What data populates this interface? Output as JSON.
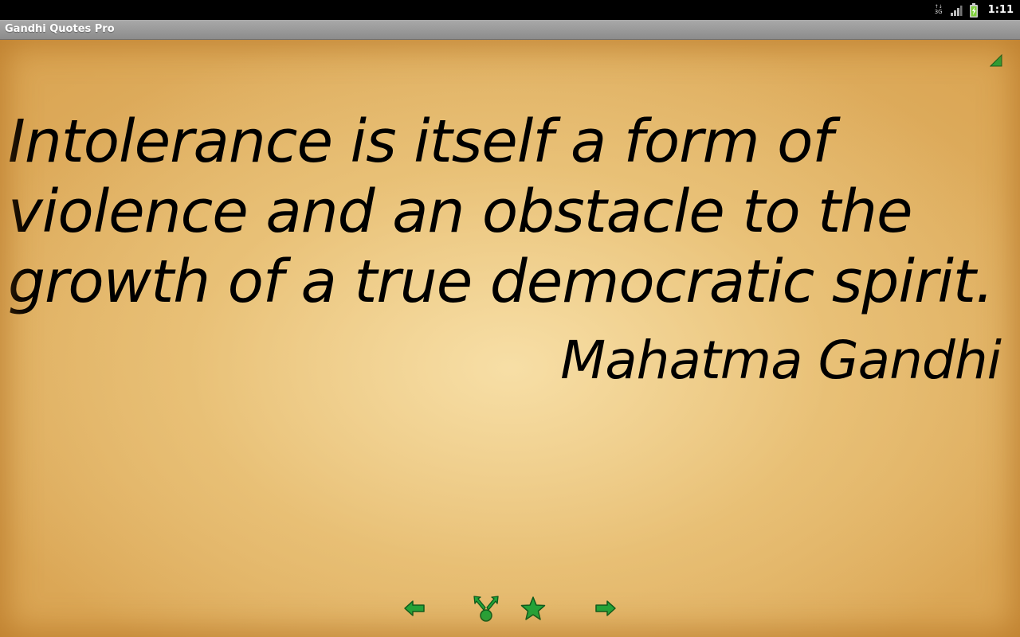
{
  "status_bar": {
    "network_type": "3G",
    "time": "1:11"
  },
  "app": {
    "title": "Gandhi Quotes Pro"
  },
  "quote": {
    "text": "Intolerance is itself a form of violence and an obstacle to the growth of a true democratic spirit.",
    "author": "Mahatma Gandhi"
  },
  "toolbar": {
    "buttons": [
      {
        "icon": "arrow-left-icon"
      },
      {
        "icon": "share-icon"
      },
      {
        "icon": "star-icon"
      },
      {
        "icon": "arrow-right-icon"
      }
    ]
  },
  "colors": {
    "icon_green": "#1fa53a",
    "icon_outline": "#0b5a1c",
    "text": "#000000"
  }
}
